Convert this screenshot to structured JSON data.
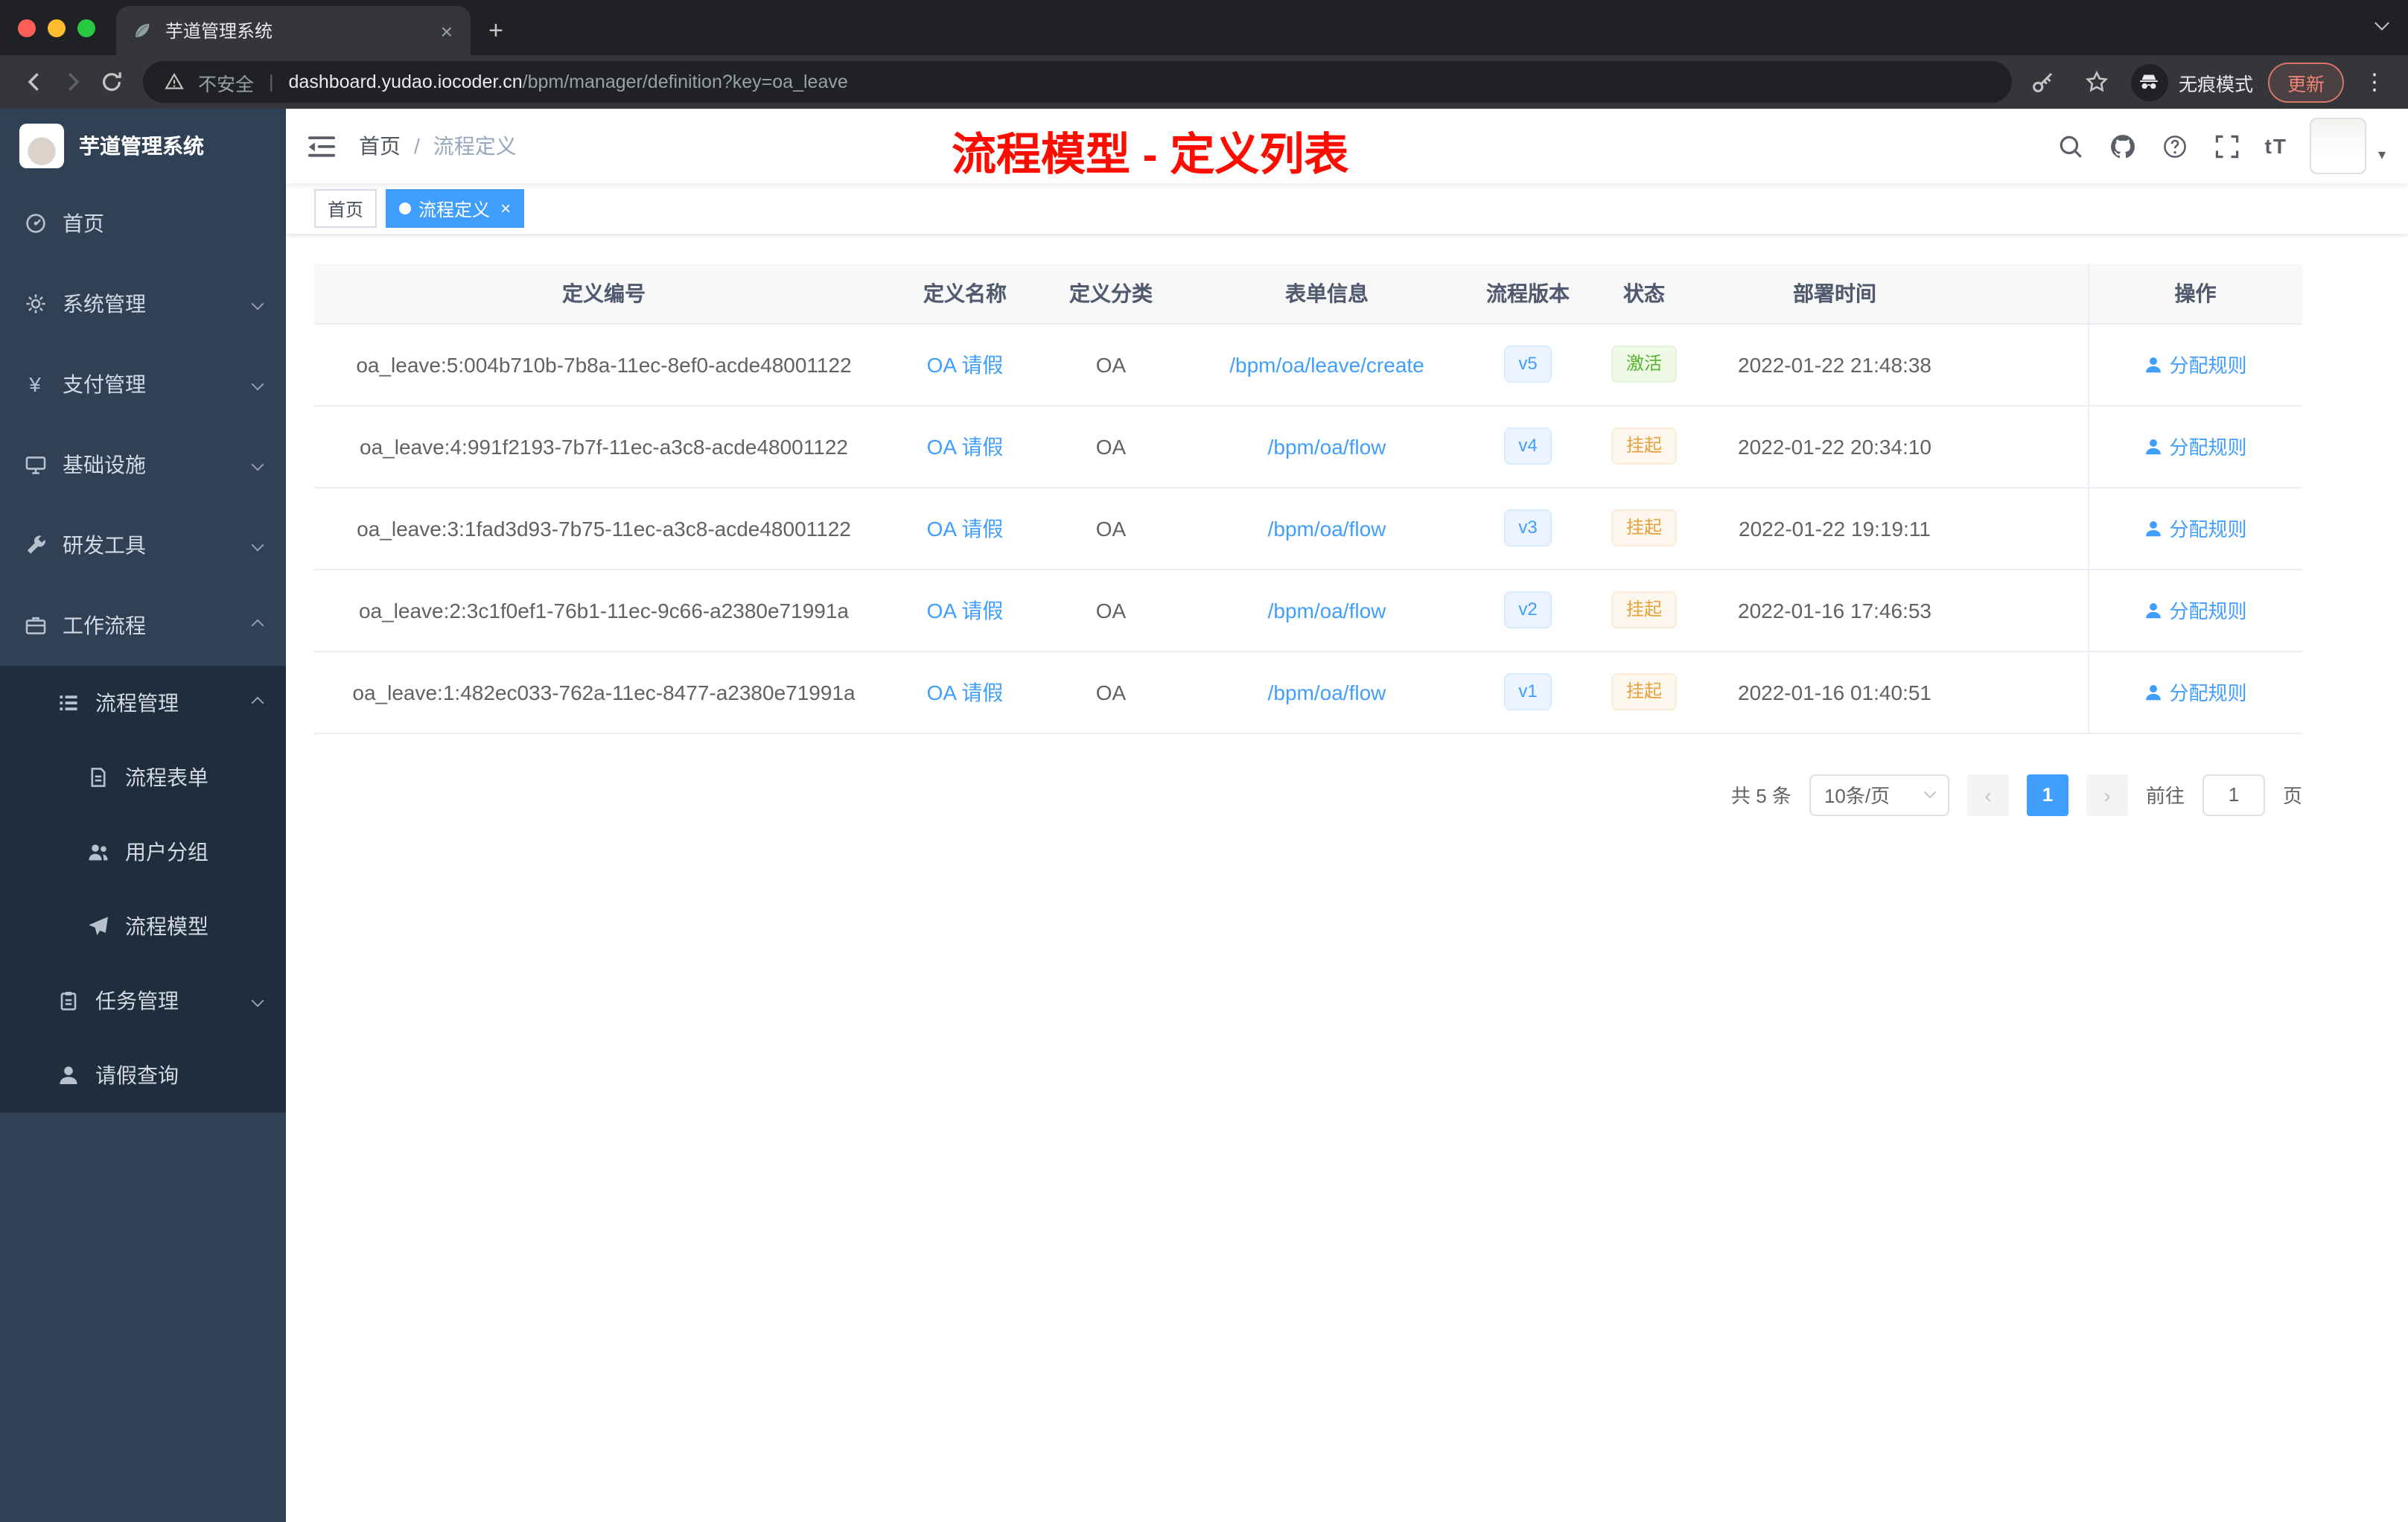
{
  "chrome": {
    "tab": {
      "title": "芋道管理系统"
    },
    "address": {
      "security_label": "不安全",
      "url_host": "dashboard.yudao.iocoder.cn",
      "url_path": "/bpm/manager/definition?key=oa_leave"
    },
    "incognito_label": "无痕模式",
    "update_label": "更新"
  },
  "sidebar": {
    "logo_title": "芋道管理系统",
    "items": [
      {
        "id": "home",
        "label": "首页",
        "icon": "dashboard-icon",
        "level": 1,
        "dark": false
      },
      {
        "id": "system-manage",
        "label": "系统管理",
        "icon": "gear-icon",
        "level": 1,
        "dark": false,
        "chevron": "down"
      },
      {
        "id": "pay-manage",
        "label": "支付管理",
        "icon": "yen-icon",
        "level": 1,
        "dark": false,
        "chevron": "down"
      },
      {
        "id": "infrastructure",
        "label": "基础设施",
        "icon": "monitor-icon",
        "level": 1,
        "dark": false,
        "chevron": "down"
      },
      {
        "id": "dev-tools",
        "label": "研发工具",
        "icon": "wrench-icon",
        "level": 1,
        "dark": false,
        "chevron": "down"
      },
      {
        "id": "workflow",
        "label": "工作流程",
        "icon": "briefcase-icon",
        "level": 1,
        "dark": false,
        "chevron": "up"
      },
      {
        "id": "process-manage",
        "label": "流程管理",
        "icon": "list-icon",
        "level": 2,
        "dark": true,
        "chevron": "up"
      },
      {
        "id": "process-form",
        "label": "流程表单",
        "icon": "document-icon",
        "level": 3,
        "dark": true
      },
      {
        "id": "user-group",
        "label": "用户分组",
        "icon": "people-icon",
        "level": 3,
        "dark": true
      },
      {
        "id": "process-model",
        "label": "流程模型",
        "icon": "paper-plane-icon",
        "level": 3,
        "dark": true
      },
      {
        "id": "task-manage",
        "label": "任务管理",
        "icon": "clipboard-icon",
        "level": 2,
        "dark": true,
        "chevron": "down"
      },
      {
        "id": "leave-query",
        "label": "请假查询",
        "icon": "user-icon",
        "level": 2,
        "dark": true
      }
    ]
  },
  "navbar": {
    "breadcrumb": {
      "root": "首页",
      "separator": "/",
      "current": "流程定义"
    },
    "annotation": "流程模型 - 定义列表"
  },
  "tags": [
    {
      "label": "首页",
      "active": false,
      "closable": false
    },
    {
      "label": "流程定义",
      "active": true,
      "closable": true
    }
  ],
  "table": {
    "columns": [
      "定义编号",
      "定义名称",
      "定义分类",
      "表单信息",
      "流程版本",
      "状态",
      "部署时间",
      "操作"
    ],
    "action_label": "分配规则",
    "rows": [
      {
        "id": "oa_leave:5:004b710b-7b8a-11ec-8ef0-acde48001122",
        "name": "OA 请假",
        "category": "OA",
        "form": "/bpm/oa/leave/create",
        "version": "v5",
        "status": "激活",
        "status_type": "success",
        "deploy_time": "2022-01-22 21:48:38"
      },
      {
        "id": "oa_leave:4:991f2193-7b7f-11ec-a3c8-acde48001122",
        "name": "OA 请假",
        "category": "OA",
        "form": "/bpm/oa/flow",
        "version": "v4",
        "status": "挂起",
        "status_type": "warning",
        "deploy_time": "2022-01-22 20:34:10"
      },
      {
        "id": "oa_leave:3:1fad3d93-7b75-11ec-a3c8-acde48001122",
        "name": "OA 请假",
        "category": "OA",
        "form": "/bpm/oa/flow",
        "version": "v3",
        "status": "挂起",
        "status_type": "warning",
        "deploy_time": "2022-01-22 19:19:11"
      },
      {
        "id": "oa_leave:2:3c1f0ef1-76b1-11ec-9c66-a2380e71991a",
        "name": "OA 请假",
        "category": "OA",
        "form": "/bpm/oa/flow",
        "version": "v2",
        "status": "挂起",
        "status_type": "warning",
        "deploy_time": "2022-01-16 17:46:53"
      },
      {
        "id": "oa_leave:1:482ec033-762a-11ec-8477-a2380e71991a",
        "name": "OA 请假",
        "category": "OA",
        "form": "/bpm/oa/flow",
        "version": "v1",
        "status": "挂起",
        "status_type": "warning",
        "deploy_time": "2022-01-16 01:40:51"
      }
    ]
  },
  "pagination": {
    "total": "共 5 条",
    "page_size": "10条/页",
    "current_page": "1",
    "goto_label": "前往",
    "goto_value": "1",
    "page_unit": "页"
  },
  "colors": {
    "accent": "#409eff",
    "success": "#67c23a",
    "warning": "#e6a23c",
    "annotation": "#ff0000",
    "sidebar_bg": "#304156",
    "sidebar_submenu_bg": "#1f2d3d"
  }
}
